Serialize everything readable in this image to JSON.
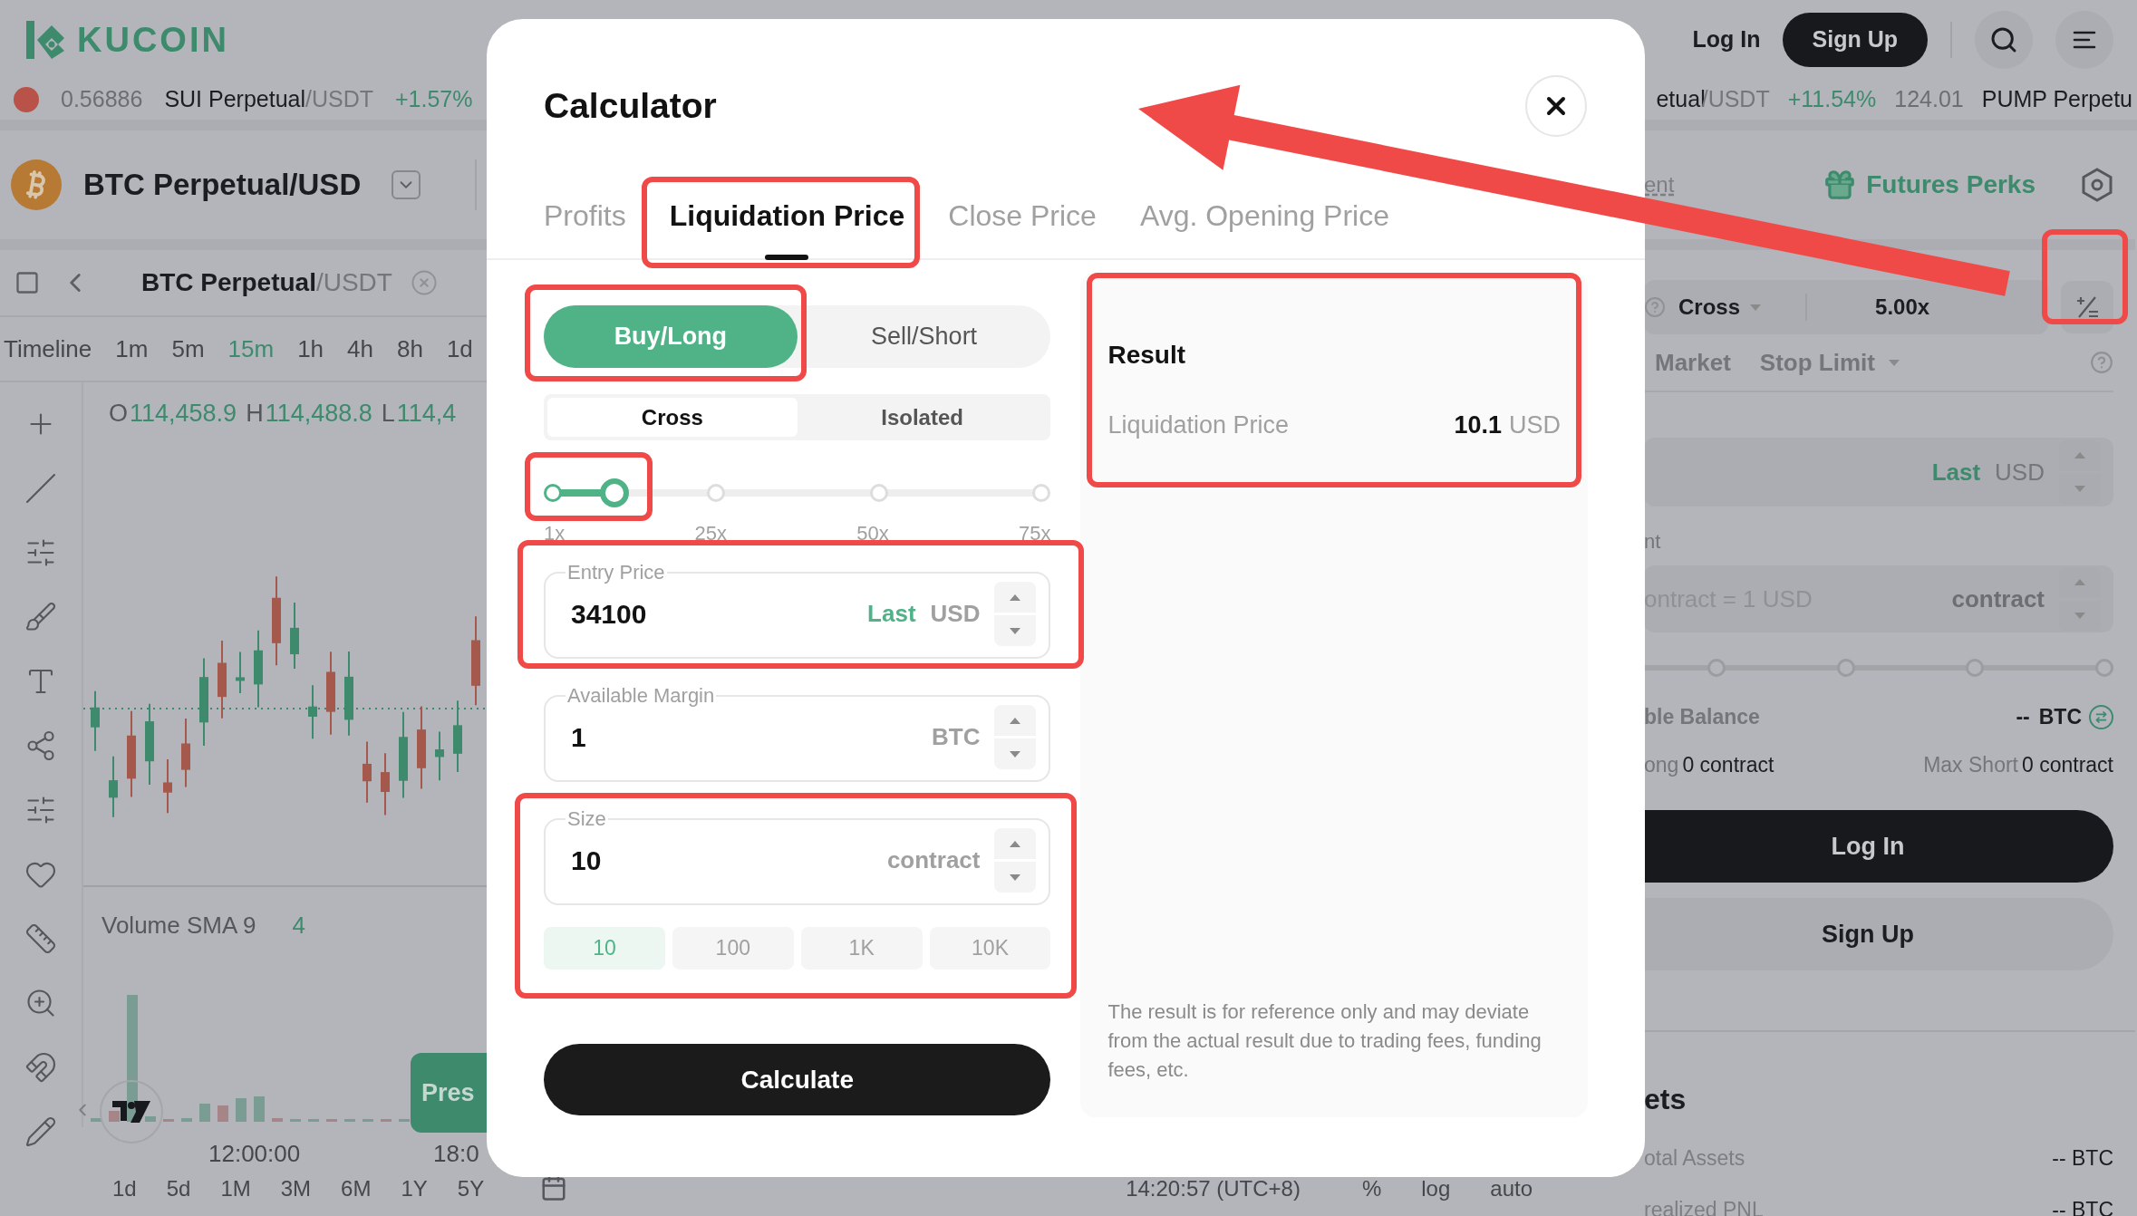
{
  "header": {
    "logo": "KUCOIN",
    "login": "Log In",
    "signup": "Sign Up"
  },
  "ticker_left": [
    {
      "text": "0.56886",
      "kind": "price"
    },
    {
      "text": "SUI Perpetual",
      "kind": "pair"
    },
    {
      "text": "/USDT",
      "kind": "quote"
    },
    {
      "text": "+1.57%",
      "kind": "change"
    }
  ],
  "ticker_right": [
    {
      "text": "etual",
      "kind": "pair"
    },
    {
      "text": "/USDT",
      "kind": "quote"
    },
    {
      "text": "+11.54%",
      "kind": "change"
    },
    {
      "text": "124.01",
      "kind": "price"
    },
    {
      "text": "PUMP Perpetu",
      "kind": "pair"
    }
  ],
  "pair": {
    "name": "BTC Perpetual/USD"
  },
  "chart_toolbar": {
    "symbol": "BTC Perpetual",
    "quote": "/USDT"
  },
  "timeframes": [
    {
      "label": "Timeline",
      "selected": false
    },
    {
      "label": "1m",
      "selected": false
    },
    {
      "label": "5m",
      "selected": false
    },
    {
      "label": "15m",
      "selected": true
    },
    {
      "label": "1h",
      "selected": false
    },
    {
      "label": "4h",
      "selected": false
    },
    {
      "label": "8h",
      "selected": false
    },
    {
      "label": "1d",
      "selected": false
    }
  ],
  "ohlc": [
    {
      "key": "O",
      "value": "114,458.9"
    },
    {
      "key": "H",
      "value": "114,488.8"
    },
    {
      "key": "L",
      "value": "114,4"
    }
  ],
  "volume": {
    "label": "Volume SMA 9",
    "value": "4"
  },
  "promo_button": "Pres",
  "time_axis": [
    "12:00:00",
    "18:0"
  ],
  "ranges": [
    "1d",
    "5d",
    "1M",
    "3M",
    "6M",
    "1Y",
    "5Y"
  ],
  "status": {
    "time": "14:20:57 (UTC+8)",
    "items": [
      "%",
      "log",
      "auto"
    ]
  },
  "order_panel": {
    "mode_link": "ent",
    "perks": "Futures Perks",
    "margin_mode": "Cross",
    "leverage": "5.00x",
    "order_types": [
      {
        "label": "Market",
        "dropdown": false
      },
      {
        "label": "Stop Limit",
        "dropdown": true
      }
    ],
    "price_field": {
      "tag": "Last",
      "unit": "USD"
    },
    "size_label": "nt",
    "size_field": {
      "placeholder": "ontract = 1 USD",
      "unit": "contract"
    },
    "balance": {
      "label": "ble Balance",
      "value": "--",
      "unit": "BTC"
    },
    "max_long": {
      "label": "ong",
      "value": "0 contract"
    },
    "max_short": {
      "label": "Max Short",
      "value": "0 contract"
    },
    "login": "Log In",
    "signup": "Sign Up",
    "assets": {
      "title": "ets",
      "rows": [
        {
          "label": "otal Assets",
          "value": "-- BTC"
        },
        {
          "label": "realized PNL",
          "value": "-- BTC"
        }
      ]
    }
  },
  "calculator": {
    "title": "Calculator",
    "tabs": [
      {
        "label": "Profits",
        "selected": false
      },
      {
        "label": "Liquidation Price",
        "selected": true
      },
      {
        "label": "Close Price",
        "selected": false
      },
      {
        "label": "Avg. Opening Price",
        "selected": false
      }
    ],
    "sides": [
      {
        "label": "Buy/Long",
        "selected": true
      },
      {
        "label": "Sell/Short",
        "selected": false
      }
    ],
    "margin_modes": [
      {
        "label": "Cross",
        "selected": true
      },
      {
        "label": "Isolated",
        "selected": false
      }
    ],
    "leverage": {
      "level": 0.126,
      "marks": [
        "1x",
        "25x",
        "50x",
        "75x"
      ]
    },
    "fields": [
      {
        "label": "Entry Price",
        "value": "34100",
        "tag": "Last",
        "unit": "USD"
      },
      {
        "label": "Available Margin",
        "value": "1",
        "unit": "BTC"
      },
      {
        "label": "Size",
        "value": "10",
        "unit": "contract"
      }
    ],
    "size_presets": [
      {
        "label": "10",
        "selected": true
      },
      {
        "label": "100",
        "selected": false
      },
      {
        "label": "1K",
        "selected": false
      },
      {
        "label": "10K",
        "selected": false
      }
    ],
    "calculate": "Calculate",
    "result": {
      "title": "Result",
      "rows": [
        {
          "label": "Liquidation Price",
          "value": "10.1",
          "unit": "USD"
        }
      ]
    },
    "disclaimer": "The result is for reference only and may deviate from the actual result due to trading fees, funding fees, etc."
  }
}
